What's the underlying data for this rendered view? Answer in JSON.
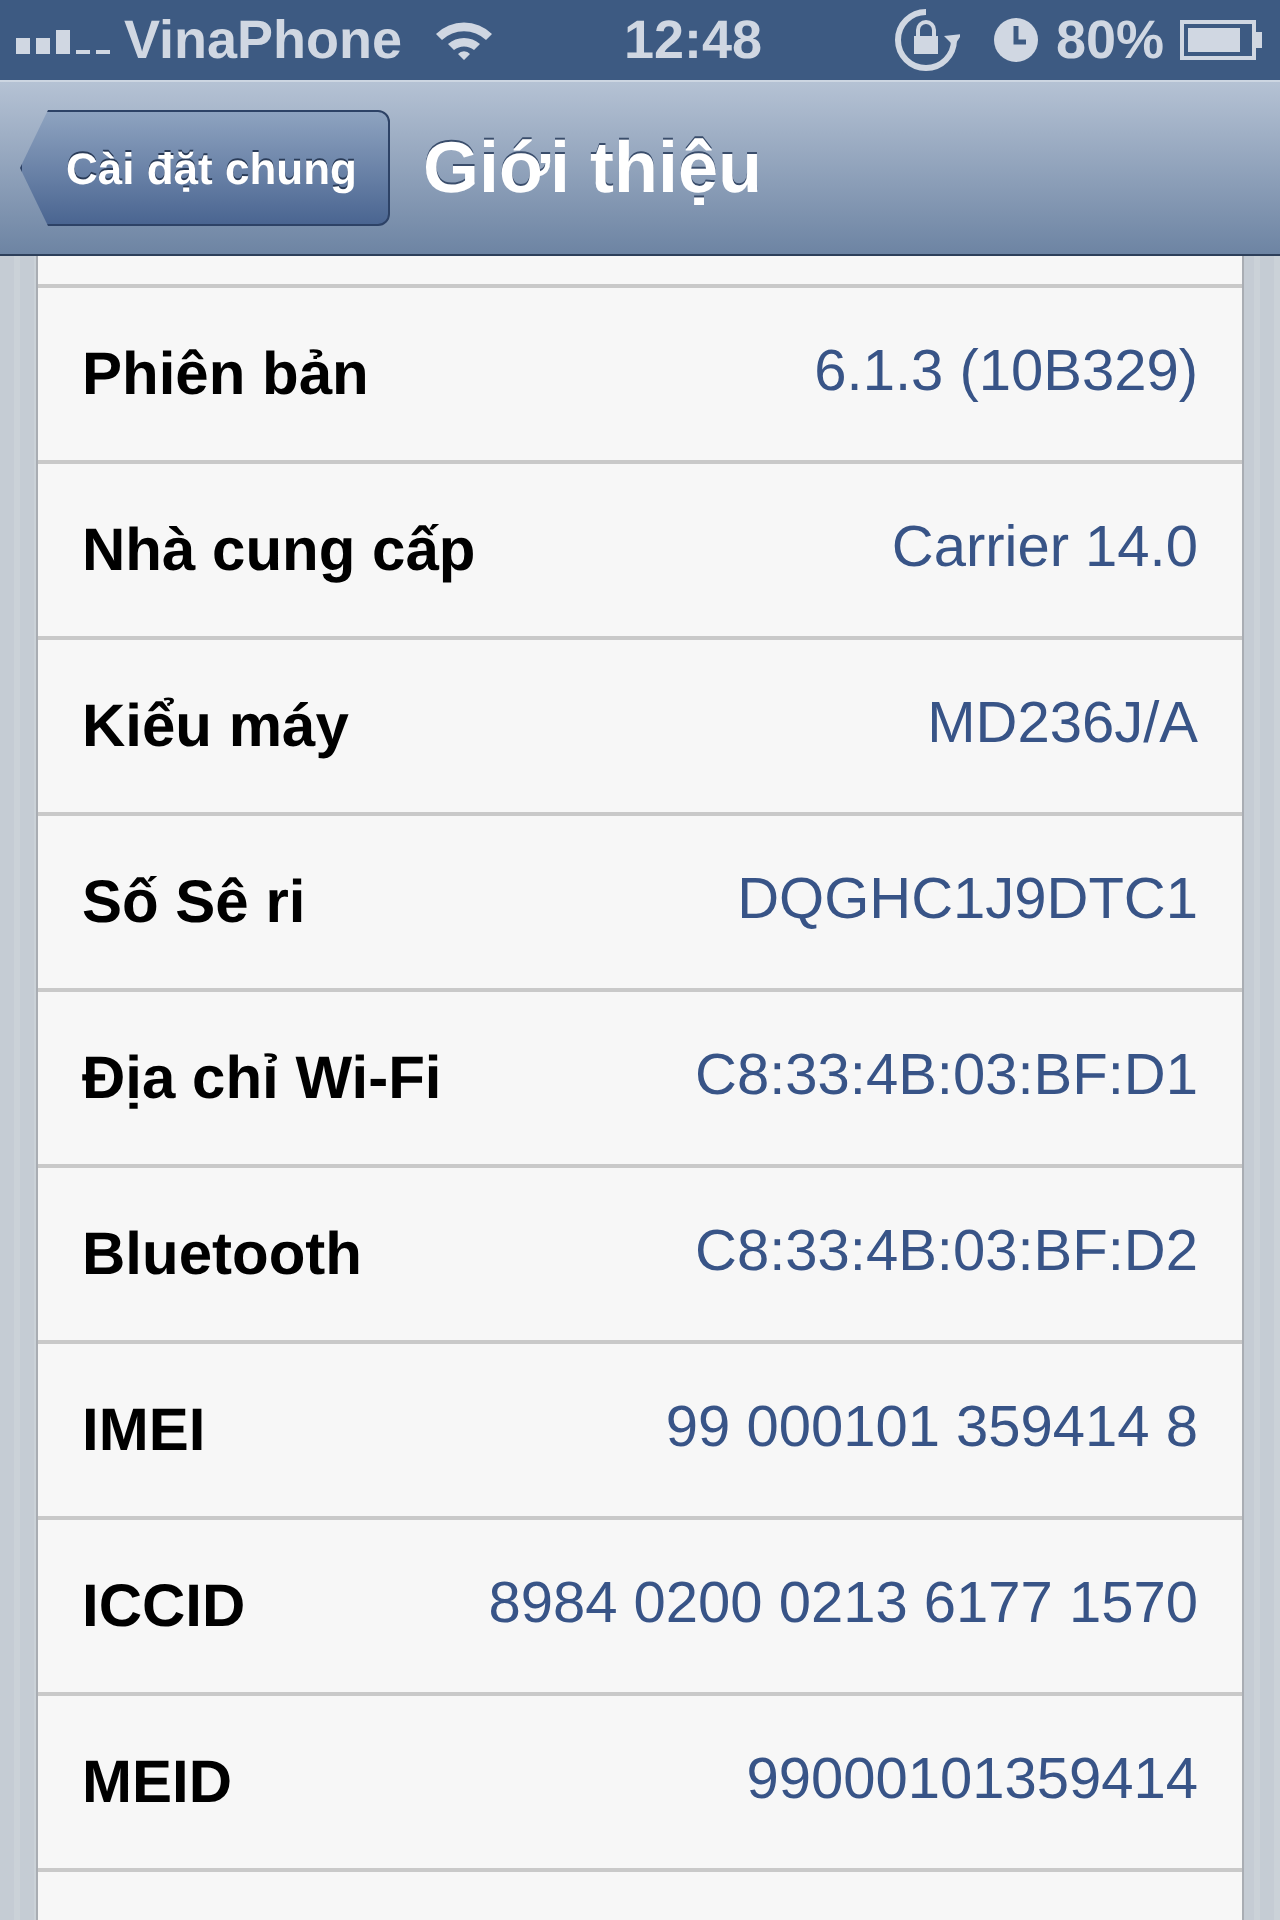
{
  "status_bar": {
    "carrier": "VinaPhone",
    "time": "12:48",
    "battery": "80%"
  },
  "nav_bar": {
    "back": "Cài đặt chung",
    "title": "Giới thiệu"
  },
  "rows": [
    {
      "label": "Phiên bản",
      "value": "6.1.3 (10B329)"
    },
    {
      "label": "Nhà cung cấp",
      "value": "Carrier 14.0"
    },
    {
      "label": "Kiểu máy",
      "value": "MD236J/A"
    },
    {
      "label": "Số Sê ri",
      "value": "DQGHC1J9DTC1"
    },
    {
      "label": "Địa chỉ Wi-Fi",
      "value": "C8:33:4B:03:BF:D1"
    },
    {
      "label": "Bluetooth",
      "value": "C8:33:4B:03:BF:D2"
    },
    {
      "label": "IMEI",
      "value": "99 000101 359414 8"
    },
    {
      "label": "ICCID",
      "value": "8984 0200 0213 6177 1570"
    },
    {
      "label": "MEID",
      "value": "99000101359414"
    }
  ]
}
